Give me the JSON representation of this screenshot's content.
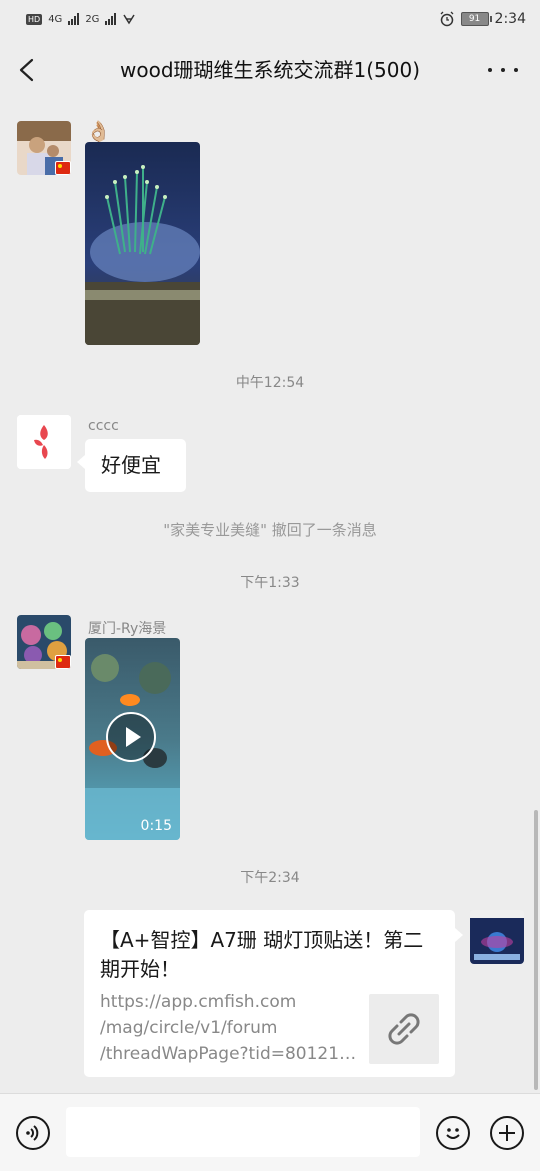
{
  "status": {
    "left_badge": "HD",
    "net1": "4G",
    "net2": "2G",
    "battery": "91",
    "time": "2:34"
  },
  "header": {
    "title": "wood珊瑚维生系统交流群1(500)"
  },
  "messages": [
    {
      "type": "image",
      "emoji": "👌🏼"
    },
    {
      "type": "timestamp",
      "text": "中午12:54"
    },
    {
      "type": "text",
      "sender": "cccc",
      "text": "好便宜"
    },
    {
      "type": "system",
      "text": "\"家美专业美缝\" 撤回了一条消息"
    },
    {
      "type": "timestamp",
      "text": "下午1:33"
    },
    {
      "type": "video",
      "sender": "厦门-Ry海景",
      "duration": "0:15"
    },
    {
      "type": "timestamp",
      "text": "下午2:34"
    },
    {
      "type": "link",
      "title": "【A+智控】A7珊 瑚灯顶贴送！第二期开始！",
      "url_lines": [
        "https://app.cmfish.com",
        "/mag/circle/v1/forum",
        "/threadWapPage?tid=80121…"
      ]
    }
  ],
  "colors": {
    "background": "#ededed",
    "bubble": "#ffffff",
    "timestamp": "#888888"
  },
  "icons": [
    "back-icon",
    "more-icon",
    "voice-icon",
    "emoji-icon",
    "plus-icon",
    "play-icon",
    "link-icon"
  ]
}
